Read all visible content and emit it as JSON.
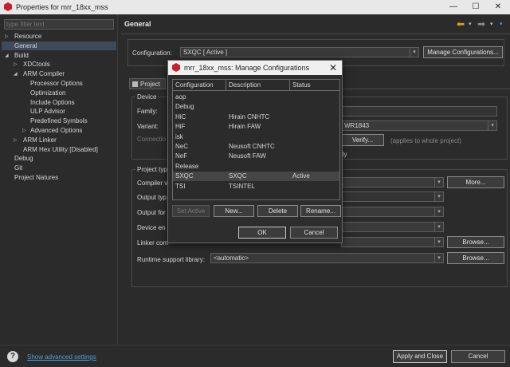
{
  "window": {
    "title": "Properties for mrr_18xx_mss",
    "minimize": "—",
    "maximize": "☐",
    "close": "✕"
  },
  "filter": {
    "placeholder": "type filter text"
  },
  "tree": [
    {
      "label": "Resource",
      "twisty": "▷"
    },
    {
      "label": "General",
      "twisty": ""
    },
    {
      "label": "Build",
      "twisty": "◢"
    },
    {
      "label": "XDCtools",
      "twisty": "▷"
    },
    {
      "label": "ARM Compiler",
      "twisty": "◢"
    },
    {
      "label": "Processor Options",
      "twisty": ""
    },
    {
      "label": "Optimization",
      "twisty": ""
    },
    {
      "label": "Include Options",
      "twisty": ""
    },
    {
      "label": "ULP Advisor",
      "twisty": ""
    },
    {
      "label": "Predefined Symbols",
      "twisty": ""
    },
    {
      "label": "Advanced Options",
      "twisty": "▷"
    },
    {
      "label": "ARM Linker",
      "twisty": "▷"
    },
    {
      "label": "ARM Hex Utility  [Disabled]",
      "twisty": ""
    },
    {
      "label": "Debug",
      "twisty": ""
    },
    {
      "label": "Git",
      "twisty": ""
    },
    {
      "label": "Project Natures",
      "twisty": ""
    }
  ],
  "page": {
    "header": "General",
    "configuration_label": "Configuration:",
    "configuration_value": "SXQC  [ Active ]",
    "manage_button": "Manage Configurations...",
    "tab_project": "Project",
    "device_group": "Device",
    "family_label": "Family:",
    "variant_label": "Variant:",
    "variant_value": "WR1843",
    "connection_label": "Connectio",
    "verify_button": "Verify...",
    "verify_note": "(applies to whole project)",
    "ly_text": "lly",
    "project_group": "Project typ",
    "compiler_label": "Compiler v",
    "more_button": "More...",
    "output_type_label": "Output typ",
    "output_format_label": "Output for",
    "device_endian_label": "Device en",
    "linker_cmd_label": "Linker com",
    "browse_button_1": "Browse...",
    "runtime_label": "Runtime support library:",
    "runtime_value": "<automatic>",
    "browse_button_2": "Browse..."
  },
  "dialog": {
    "title": "mrr_18xx_mss: Manage Configurations",
    "columns": [
      "Configuration",
      "Description",
      "Status"
    ],
    "rows": [
      {
        "name": "aop",
        "description": "",
        "status": ""
      },
      {
        "name": "Debug",
        "description": "",
        "status": ""
      },
      {
        "name": "HiC",
        "description": "Hirain CNHTC",
        "status": ""
      },
      {
        "name": "HiF",
        "description": "Hirain FAW",
        "status": ""
      },
      {
        "name": "isk",
        "description": "",
        "status": ""
      },
      {
        "name": "NeC",
        "description": "Neusoft CNHTC",
        "status": ""
      },
      {
        "name": "NeF",
        "description": "Neusoft FAW",
        "status": ""
      },
      {
        "name": "Release",
        "description": "",
        "status": ""
      },
      {
        "name": "SXQC",
        "description": "SXQC",
        "status": "Active"
      },
      {
        "name": "TSI",
        "description": "TSINTEL",
        "status": ""
      }
    ],
    "set_active_button": "Set Active",
    "new_button": "New...",
    "delete_button": "Delete",
    "rename_button": "Rename...",
    "ok_button": "OK",
    "cancel_button": "Cancel"
  },
  "footer": {
    "help": "?",
    "show_advanced": "Show advanced settings",
    "apply_close": "Apply and Close",
    "cancel": "Cancel"
  },
  "colors": {
    "accent_link": "#4a9fe0",
    "nav_arrow": "#e0a020",
    "brand_icon": "#c8202a"
  }
}
